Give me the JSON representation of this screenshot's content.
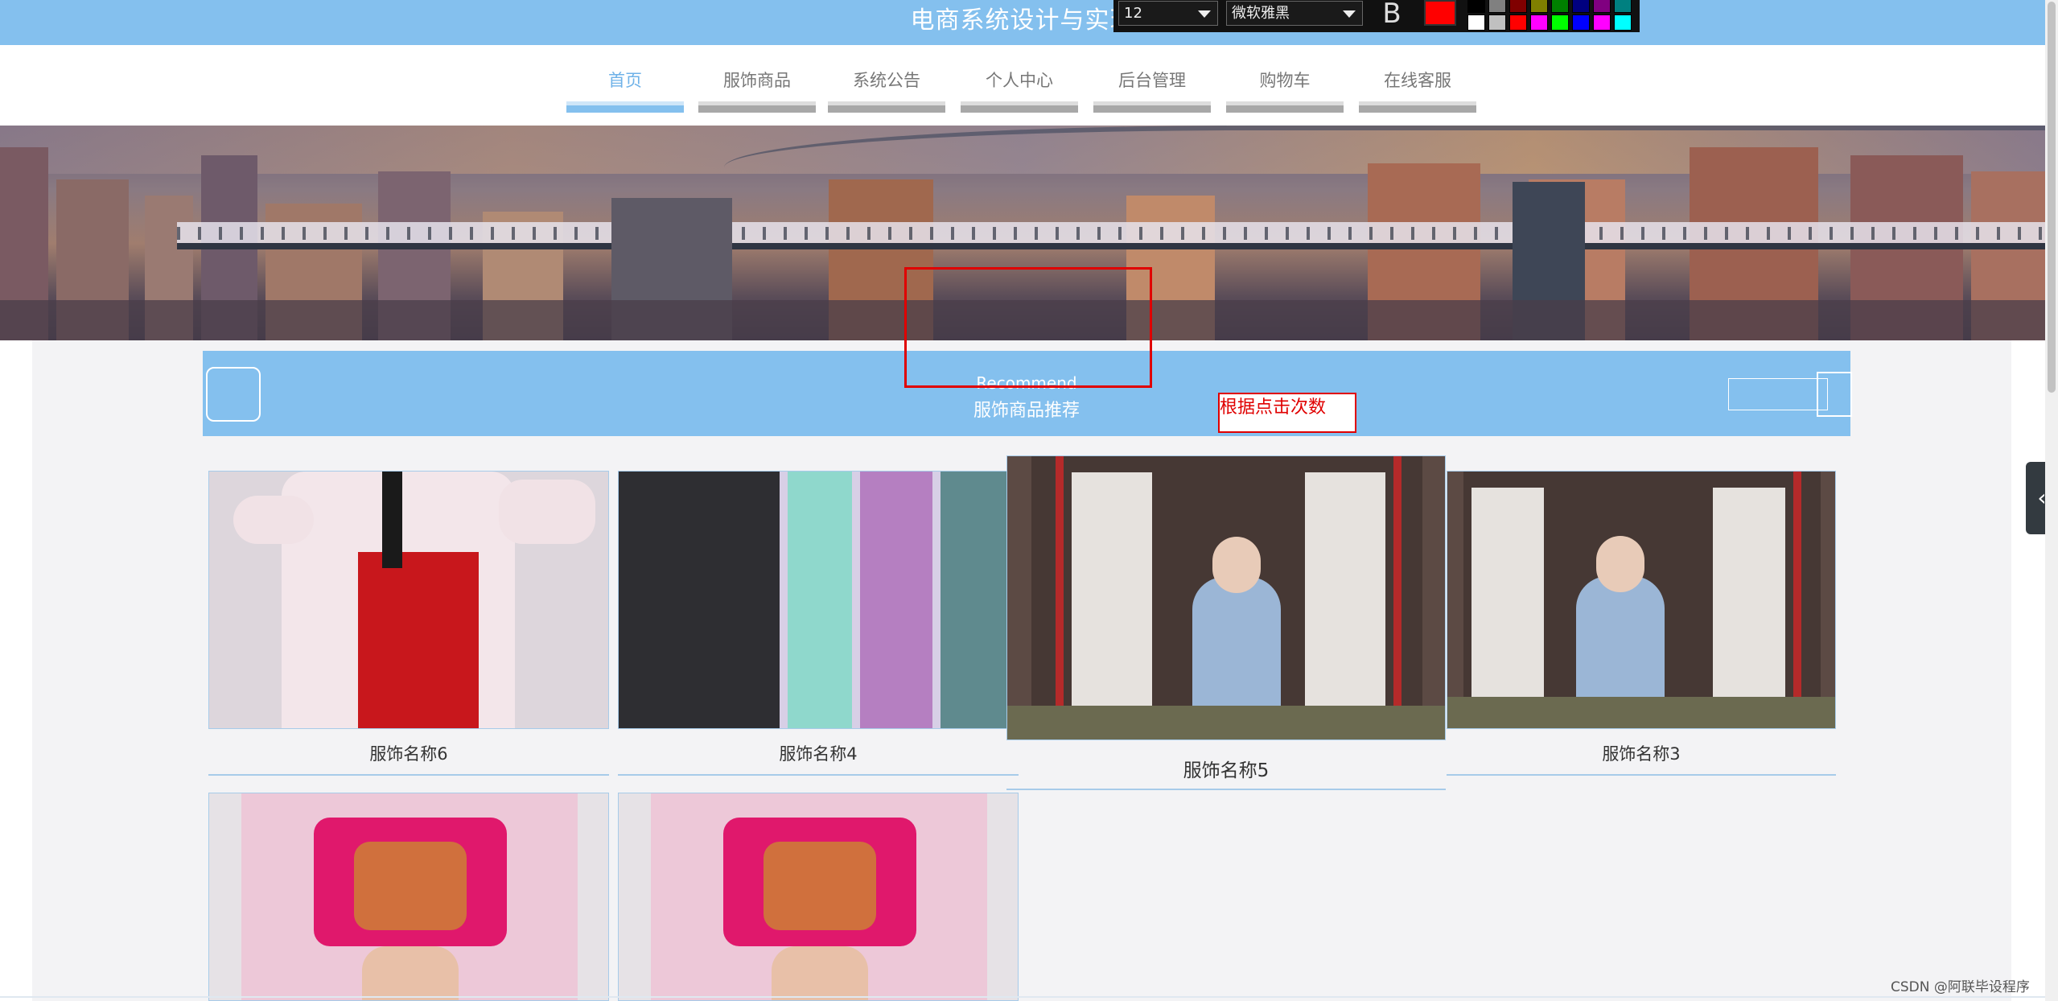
{
  "site": {
    "title": "电商系统设计与实现"
  },
  "nav": {
    "items": [
      {
        "label": "首页",
        "active": true
      },
      {
        "label": "服饰商品",
        "active": false
      },
      {
        "label": "系统公告",
        "active": false
      },
      {
        "label": "个人中心",
        "active": false
      },
      {
        "label": "后台管理",
        "active": false
      },
      {
        "label": "购物车",
        "active": false
      },
      {
        "label": "在线客服",
        "active": false
      }
    ]
  },
  "editor": {
    "font_size": "12",
    "font_family": "微软雅黑",
    "bold_label": "B",
    "current_color": "#ff0000",
    "palette": [
      "#000000",
      "#808080",
      "#800000",
      "#808000",
      "#008000",
      "#000080",
      "#800080",
      "#008080",
      "#ffffff",
      "#c0c0c0",
      "#ff0000",
      "#ff00ff",
      "#00ff00",
      "#0000ff",
      "#ff00ff",
      "#00ffff"
    ]
  },
  "recommend": {
    "title_en": "Recommend",
    "title_zh": "服饰商品推荐"
  },
  "annotation": {
    "text": "根据点击次数"
  },
  "products": [
    {
      "name": "服饰名称6"
    },
    {
      "name": "服饰名称4"
    },
    {
      "name": "服饰名称5"
    },
    {
      "name": "服饰名称3"
    },
    {
      "name": ""
    },
    {
      "name": ""
    }
  ],
  "side_tab": {
    "icon": "chevron-left-icon",
    "glyph": "‹"
  },
  "watermark": {
    "text": "CSDN @阿联毕设程序"
  },
  "colors": {
    "accent": "#84c0ee",
    "annotation": "#e00000"
  }
}
